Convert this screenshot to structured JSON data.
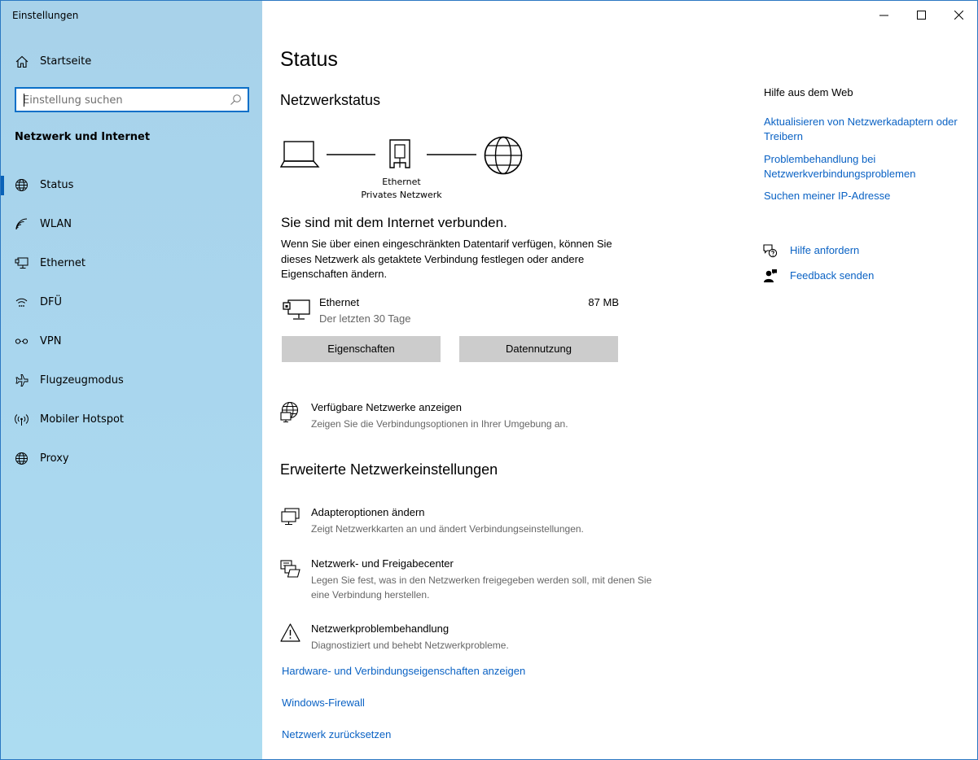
{
  "window": {
    "title": "Einstellungen"
  },
  "sidebar": {
    "home_label": "Startseite",
    "search_placeholder": "Einstellung suchen",
    "section_title": "Netzwerk und Internet",
    "items": [
      {
        "label": "Status",
        "icon": "globe-icon",
        "active": true
      },
      {
        "label": "WLAN",
        "icon": "wifi-icon",
        "active": false
      },
      {
        "label": "Ethernet",
        "icon": "ethernet-icon",
        "active": false
      },
      {
        "label": "DFÜ",
        "icon": "dialup-icon",
        "active": false
      },
      {
        "label": "VPN",
        "icon": "vpn-icon",
        "active": false
      },
      {
        "label": "Flugzeugmodus",
        "icon": "airplane-icon",
        "active": false
      },
      {
        "label": "Mobiler Hotspot",
        "icon": "hotspot-icon",
        "active": false
      },
      {
        "label": "Proxy",
        "icon": "globe-icon",
        "active": false
      }
    ]
  },
  "main": {
    "title": "Status",
    "network_status_heading": "Netzwerkstatus",
    "diagram": {
      "adapter_label": "Ethernet",
      "network_label": "Privates Netzwerk"
    },
    "connected_text": "Sie sind mit dem Internet verbunden.",
    "metered_text": "Wenn Sie über einen eingeschränkten Datentarif verfügen, können Sie dieses Netzwerk als getaktete Verbindung festlegen oder andere Eigenschaften ändern.",
    "connection": {
      "name": "Ethernet",
      "period": "Der letzten 30 Tage",
      "usage": "87 MB"
    },
    "buttons": {
      "properties": "Eigenschaften",
      "data_usage": "Datennutzung"
    },
    "available_networks": {
      "title": "Verfügbare Netzwerke anzeigen",
      "desc": "Zeigen Sie die Verbindungsoptionen in Ihrer Umgebung an."
    },
    "advanced_heading": "Erweiterte Netzwerkeinstellungen",
    "advanced_items": [
      {
        "title": "Adapteroptionen ändern",
        "desc": "Zeigt Netzwerkkarten an und ändert Verbindungseinstellungen."
      },
      {
        "title": "Netzwerk- und Freigabecenter",
        "desc": "Legen Sie fest, was in den Netzwerken freigegeben werden soll, mit denen Sie eine Verbindung herstellen."
      },
      {
        "title": "Netzwerkproblembehandlung",
        "desc": "Diagnostiziert und behebt Netzwerkprobleme."
      }
    ],
    "links": {
      "hardware": "Hardware- und Verbindungseigenschaften anzeigen",
      "firewall": "Windows-Firewall",
      "reset": "Netzwerk zurücksetzen"
    }
  },
  "help": {
    "title": "Hilfe aus dem Web",
    "links": [
      "Aktualisieren von Netzwerkadaptern oder Treibern",
      "Problembehandlung bei Netzwerkverbindungsproblemen",
      "Suchen meiner IP-Adresse"
    ],
    "get_help": "Hilfe anfordern",
    "feedback": "Feedback senden"
  },
  "colors": {
    "accent": "#0a62c4",
    "sidebar_bg": "#a9d6ee",
    "button_bg": "#cccccc"
  }
}
